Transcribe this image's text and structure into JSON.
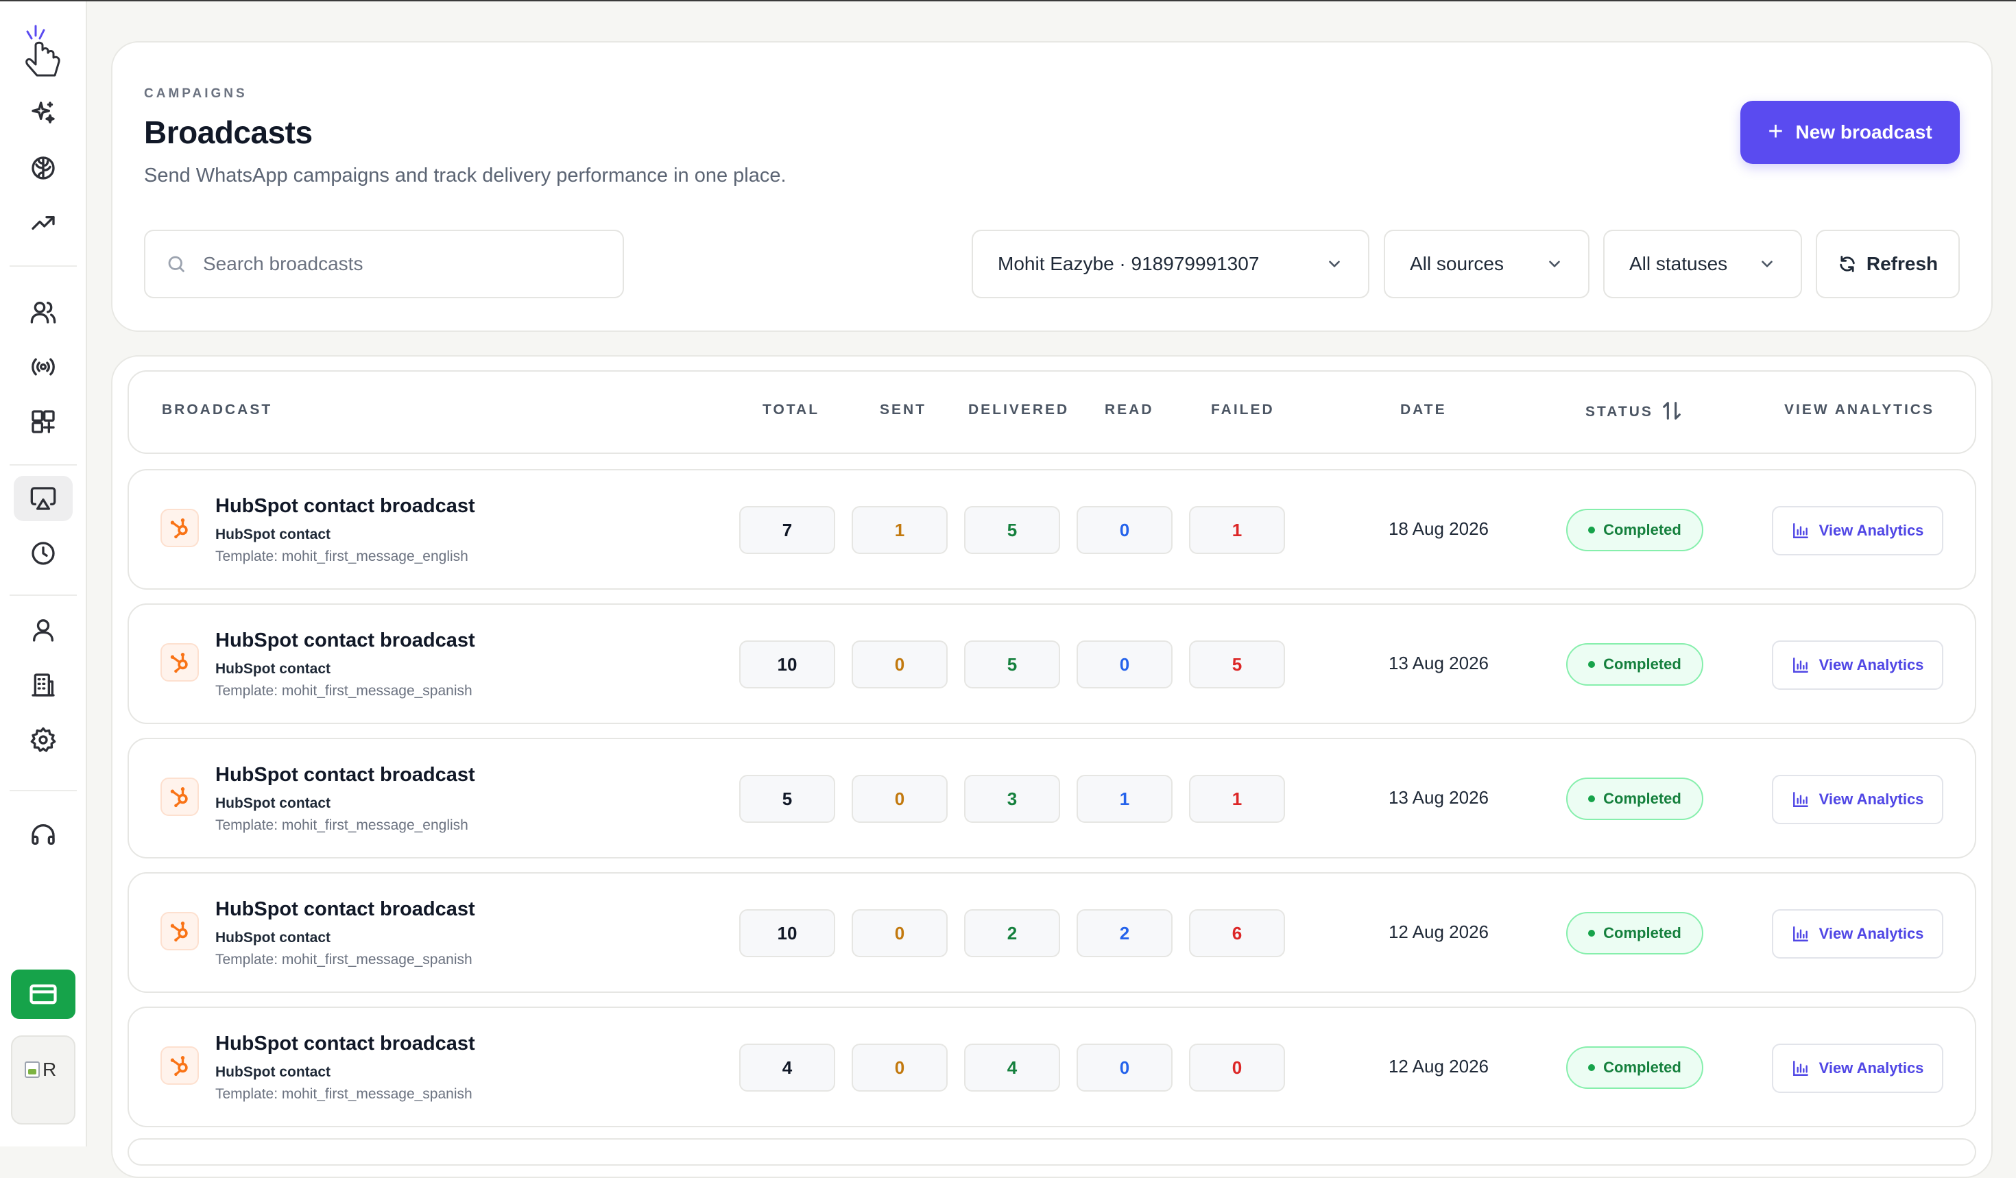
{
  "header": {
    "eyebrow": "CAMPAIGNS",
    "title": "Broadcasts",
    "subtitle": "Send WhatsApp campaigns and track delivery performance in one place.",
    "new_button_label": "New broadcast"
  },
  "filters": {
    "search_placeholder": "Search broadcasts",
    "account_selected": "Mohit Eazybe · 918979991307",
    "source_selected": "All sources",
    "status_selected": "All statuses",
    "refresh_label": "Refresh"
  },
  "table": {
    "columns": {
      "broadcast": "BROADCAST",
      "total": "TOTAL",
      "sent": "SENT",
      "delivered": "DELIVERED",
      "read": "READ",
      "failed": "FAILED",
      "date": "DATE",
      "status": "STATUS",
      "view_analytics": "VIEW ANALYTICS"
    },
    "rows": [
      {
        "name": "HubSpot contact broadcast",
        "source": "HubSpot contact",
        "template": "Template: mohit_first_message_english",
        "total": "7",
        "sent": "1",
        "delivered": "5",
        "read": "0",
        "failed": "1",
        "date": "18 Aug 2026",
        "status": "Completed",
        "action": "View Analytics"
      },
      {
        "name": "HubSpot contact broadcast",
        "source": "HubSpot contact",
        "template": "Template: mohit_first_message_spanish",
        "total": "10",
        "sent": "0",
        "delivered": "5",
        "read": "0",
        "failed": "5",
        "date": "13 Aug 2026",
        "status": "Completed",
        "action": "View Analytics"
      },
      {
        "name": "HubSpot contact broadcast",
        "source": "HubSpot contact",
        "template": "Template: mohit_first_message_english",
        "total": "5",
        "sent": "0",
        "delivered": "3",
        "read": "1",
        "failed": "1",
        "date": "13 Aug 2026",
        "status": "Completed",
        "action": "View Analytics"
      },
      {
        "name": "HubSpot contact broadcast",
        "source": "HubSpot contact",
        "template": "Template: mohit_first_message_spanish",
        "total": "10",
        "sent": "0",
        "delivered": "2",
        "read": "2",
        "failed": "6",
        "date": "12 Aug 2026",
        "status": "Completed",
        "action": "View Analytics"
      },
      {
        "name": "HubSpot contact broadcast",
        "source": "HubSpot contact",
        "template": "Template: mohit_first_message_spanish",
        "total": "4",
        "sent": "0",
        "delivered": "4",
        "read": "0",
        "failed": "0",
        "date": "12 Aug 2026",
        "status": "Completed",
        "action": "View Analytics"
      }
    ]
  },
  "sidebar": {
    "items": [
      {
        "icon": "sparkles-icon"
      },
      {
        "icon": "brain-icon"
      },
      {
        "icon": "trending-up-icon"
      },
      {
        "icon": "users-icon"
      },
      {
        "icon": "broadcast-signal-icon"
      },
      {
        "icon": "layout-plus-icon"
      },
      {
        "icon": "monitor-cast-icon",
        "active": true
      },
      {
        "icon": "clock-icon"
      },
      {
        "icon": "user-icon"
      },
      {
        "icon": "building-icon"
      },
      {
        "icon": "gear-icon"
      },
      {
        "icon": "headphones-icon"
      }
    ],
    "billing_icon": "credit-card-icon",
    "avatar_alt": "R"
  },
  "colors": {
    "primary": "#5a4bf0",
    "success": "#16a34a",
    "sent": "#c2790e",
    "read": "#2563eb",
    "failed": "#dc2626",
    "hubspot": "#f97316"
  }
}
